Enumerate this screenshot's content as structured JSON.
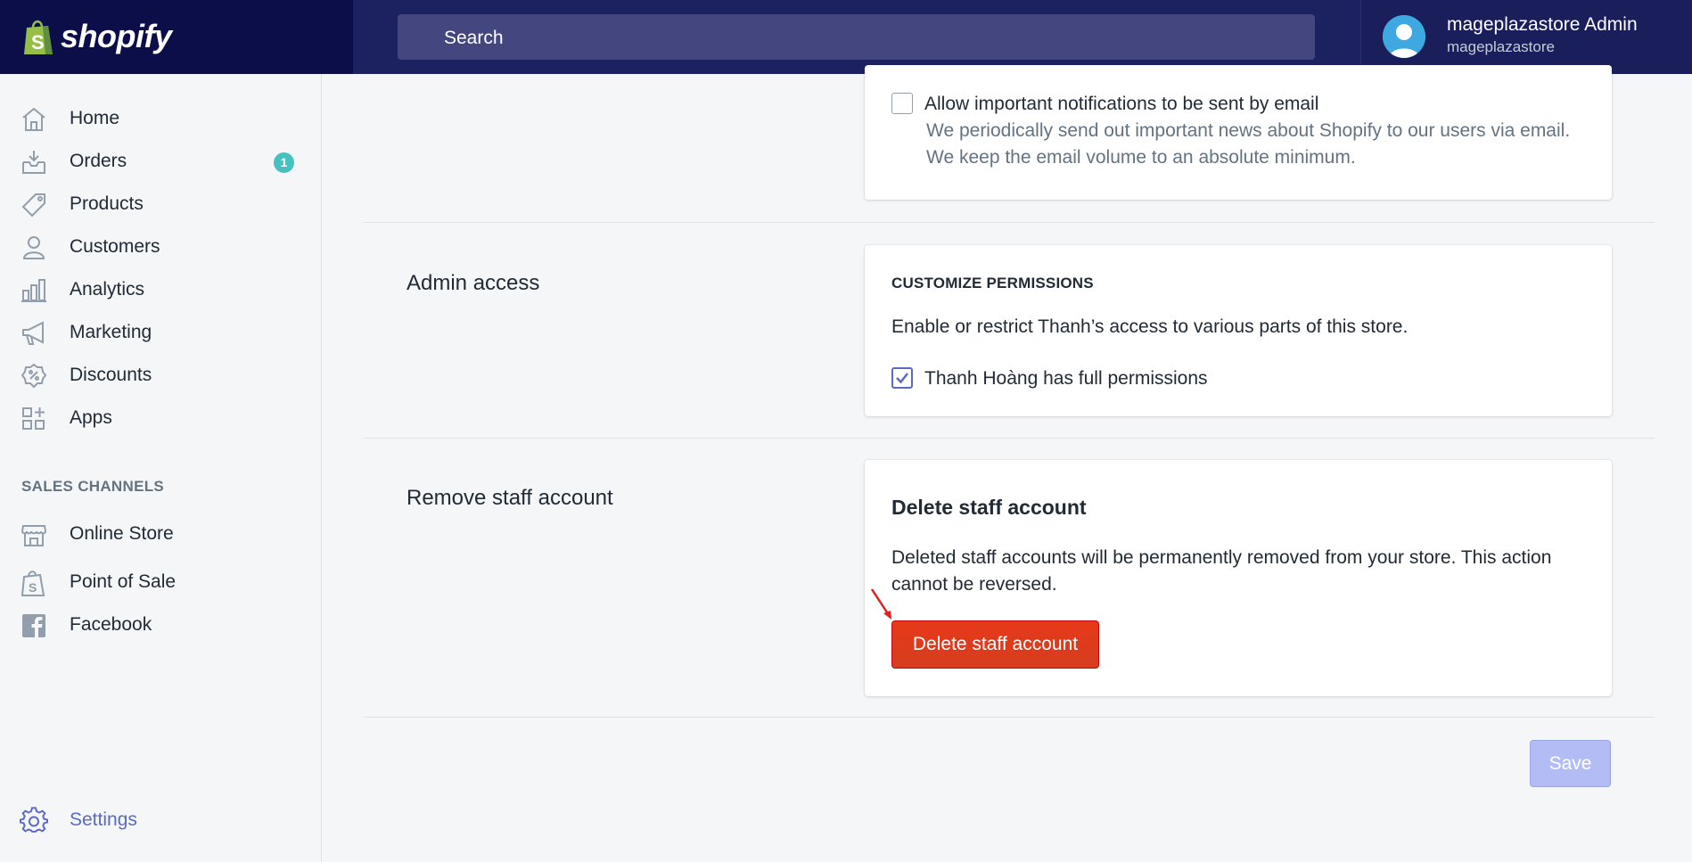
{
  "brand": {
    "name": "shopify"
  },
  "search": {
    "placeholder": "Search"
  },
  "user": {
    "name": "mageplazastore Admin",
    "store": "mageplazastore"
  },
  "sidebar": {
    "items": [
      {
        "label": "Home",
        "icon": "home-icon"
      },
      {
        "label": "Orders",
        "icon": "orders-icon",
        "badge": "1"
      },
      {
        "label": "Products",
        "icon": "tag-icon"
      },
      {
        "label": "Customers",
        "icon": "person-icon"
      },
      {
        "label": "Analytics",
        "icon": "bar-chart-icon"
      },
      {
        "label": "Marketing",
        "icon": "megaphone-icon"
      },
      {
        "label": "Discounts",
        "icon": "discount-icon"
      },
      {
        "label": "Apps",
        "icon": "apps-icon"
      }
    ],
    "sales_channels_heading": "SALES CHANNELS",
    "channels": [
      {
        "label": "Online Store",
        "icon": "store-icon"
      },
      {
        "label": "Point of Sale",
        "icon": "shopify-bag-icon"
      },
      {
        "label": "Facebook",
        "icon": "facebook-icon"
      }
    ],
    "settings_label": "Settings"
  },
  "notifications": {
    "checkbox_label": "Allow important notifications to be sent by email",
    "checked": false,
    "help_line1": "We periodically send out important news about Shopify to our users via email.",
    "help_line2": "We keep the email volume to an absolute minimum."
  },
  "admin_access": {
    "section_title": "Admin access",
    "subheading": "CUSTOMIZE PERMISSIONS",
    "description": "Enable or restrict Thanh’s access to various parts of this store.",
    "checkbox_label": "Thanh Hoàng has full permissions",
    "checked": true
  },
  "remove_account": {
    "section_title": "Remove staff account",
    "card_title": "Delete staff account",
    "description_line1": "Deleted staff accounts will be permanently removed from your store. This action",
    "description_line2": "cannot be reversed.",
    "button_label": "Delete staff account"
  },
  "footer": {
    "save_label": "Save"
  },
  "colors": {
    "topbar": "#1c2260",
    "accent": "#5c6ac4",
    "danger": "#de3618",
    "badge": "#47c1bf"
  }
}
